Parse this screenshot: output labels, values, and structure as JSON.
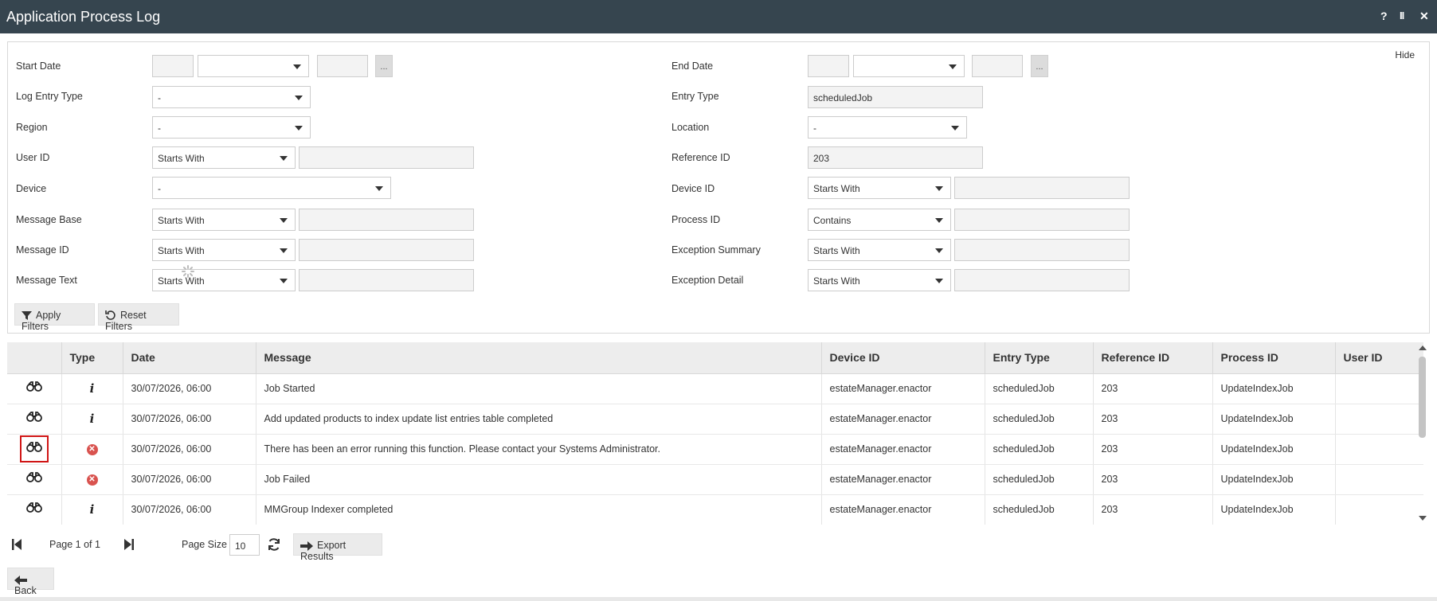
{
  "window": {
    "title": "Application Process Log",
    "help_label": "?",
    "pause_label": "II",
    "close_label": "✕"
  },
  "filters": {
    "hide_label": "Hide",
    "start_date": {
      "label": "Start Date",
      "date": "",
      "time": "",
      "extra": "",
      "dots": "..."
    },
    "end_date": {
      "label": "End Date",
      "date": "",
      "time": "",
      "extra": "",
      "dots": "..."
    },
    "log_entry_type": {
      "label": "Log Entry Type",
      "value": "-"
    },
    "entry_type": {
      "label": "Entry Type",
      "value": "scheduledJob"
    },
    "region": {
      "label": "Region",
      "value": "-"
    },
    "location": {
      "label": "Location",
      "value": "-"
    },
    "user_id": {
      "label": "User ID",
      "operator": "Starts With",
      "value": ""
    },
    "reference_id": {
      "label": "Reference ID",
      "value": "203"
    },
    "device": {
      "label": "Device",
      "value": "-"
    },
    "device_id": {
      "label": "Device ID",
      "operator": "Starts With",
      "value": ""
    },
    "message_base": {
      "label": "Message Base",
      "operator": "Starts With",
      "value": ""
    },
    "process_id": {
      "label": "Process ID",
      "operator": "Contains",
      "value": ""
    },
    "message_id": {
      "label": "Message ID",
      "operator": "Starts With",
      "value": ""
    },
    "exception_summary": {
      "label": "Exception Summary",
      "operator": "Starts With",
      "value": ""
    },
    "message_text": {
      "label": "Message Text",
      "operator": "Starts With",
      "value": ""
    },
    "exception_detail": {
      "label": "Exception Detail",
      "operator": "Starts With",
      "value": ""
    },
    "apply_label": "Apply Filters",
    "reset_label": "Reset Filters"
  },
  "grid": {
    "columns": [
      "",
      "Type",
      "Date",
      "Message",
      "Device ID",
      "Entry Type",
      "Reference ID",
      "Process ID",
      "User ID"
    ],
    "rows": [
      {
        "type": "info",
        "date": "30/07/2026, 06:00",
        "message": "Job Started",
        "device_id": "estateManager.enactor",
        "entry_type": "scheduledJob",
        "reference_id": "203",
        "process_id": "UpdateIndexJob",
        "user_id": ""
      },
      {
        "type": "info",
        "date": "30/07/2026, 06:00",
        "message": "Add updated products to index update list entries table completed",
        "device_id": "estateManager.enactor",
        "entry_type": "scheduledJob",
        "reference_id": "203",
        "process_id": "UpdateIndexJob",
        "user_id": ""
      },
      {
        "type": "error",
        "date": "30/07/2026, 06:00",
        "message": "There has been an error running this function. Please contact your Systems Administrator.",
        "device_id": "estateManager.enactor",
        "entry_type": "scheduledJob",
        "reference_id": "203",
        "process_id": "UpdateIndexJob",
        "user_id": ""
      },
      {
        "type": "error",
        "date": "30/07/2026, 06:00",
        "message": "Job Failed",
        "device_id": "estateManager.enactor",
        "entry_type": "scheduledJob",
        "reference_id": "203",
        "process_id": "UpdateIndexJob",
        "user_id": ""
      },
      {
        "type": "info",
        "date": "30/07/2026, 06:00",
        "message": "MMGroup Indexer completed",
        "device_id": "estateManager.enactor",
        "entry_type": "scheduledJob",
        "reference_id": "203",
        "process_id": "UpdateIndexJob",
        "user_id": ""
      }
    ],
    "selected_row": 2,
    "icons": {
      "view": "binoculars-icon",
      "info": "info-icon",
      "error": "error-icon"
    },
    "colors": {
      "error": "#d9534f",
      "selection": "#d01515"
    }
  },
  "pager": {
    "page_text": "Page 1 of 1",
    "page_size_label": "Page Size",
    "page_size_value": "10",
    "export_label": "Export Results"
  },
  "footer": {
    "back_label": "Back"
  },
  "theme": {
    "titlebar": "#36454f",
    "header_bg": "#ededed",
    "button_bg": "#ebebeb"
  }
}
